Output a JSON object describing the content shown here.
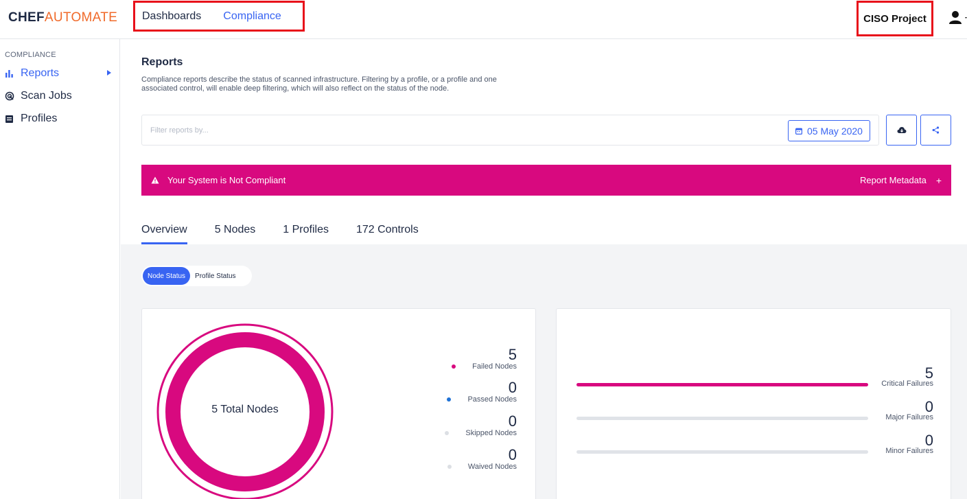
{
  "header": {
    "logo_part1": "CHEF",
    "logo_part2": "AUTOMATE",
    "nav": [
      "Dashboards",
      "Compliance"
    ],
    "project": "CISO Project",
    "user_icon": "user-icon"
  },
  "sidebar": {
    "section": "COMPLIANCE",
    "items": [
      {
        "label": "Reports",
        "icon": "bar-chart-icon",
        "active": true
      },
      {
        "label": "Scan Jobs",
        "icon": "radar-icon",
        "active": false
      },
      {
        "label": "Profiles",
        "icon": "document-icon",
        "active": false
      }
    ]
  },
  "main": {
    "title": "Reports",
    "description": "Compliance reports describe the status of scanned infrastructure. Filtering by a profile, or a profile and one associated control, will enable deep filtering, which will also reflect on the status of the node.",
    "filter_placeholder": "Filter reports by...",
    "date": "05 May 2020",
    "alert": {
      "message": "Your System is Not Compliant",
      "metadata": "Report Metadata",
      "plus": "+"
    },
    "tabs": [
      "Overview",
      "5 Nodes",
      "1 Profiles",
      "172 Controls"
    ],
    "toggle": {
      "on": "Node Status",
      "off": "Profile Status"
    }
  },
  "node_status": {
    "center_label": "5 Total Nodes",
    "stats": [
      {
        "value": "5",
        "label": "Failed Nodes",
        "color": "#d8097f"
      },
      {
        "value": "0",
        "label": "Passed Nodes",
        "color": "#1f72d6"
      },
      {
        "value": "0",
        "label": "Skipped Nodes",
        "color": "#dcdfe4"
      },
      {
        "value": "0",
        "label": "Waived Nodes",
        "color": "#dcdfe4"
      }
    ]
  },
  "failures": {
    "rows": [
      {
        "value": "5",
        "label": "Critical Failures",
        "fraction": 1.0
      },
      {
        "value": "0",
        "label": "Major Failures",
        "fraction": 0.0
      },
      {
        "value": "0",
        "label": "Minor Failures",
        "fraction": 0.0
      }
    ]
  },
  "colors": {
    "accent": "#3864f2",
    "alert": "#d8097f",
    "highlight_box": "#e8101a"
  }
}
